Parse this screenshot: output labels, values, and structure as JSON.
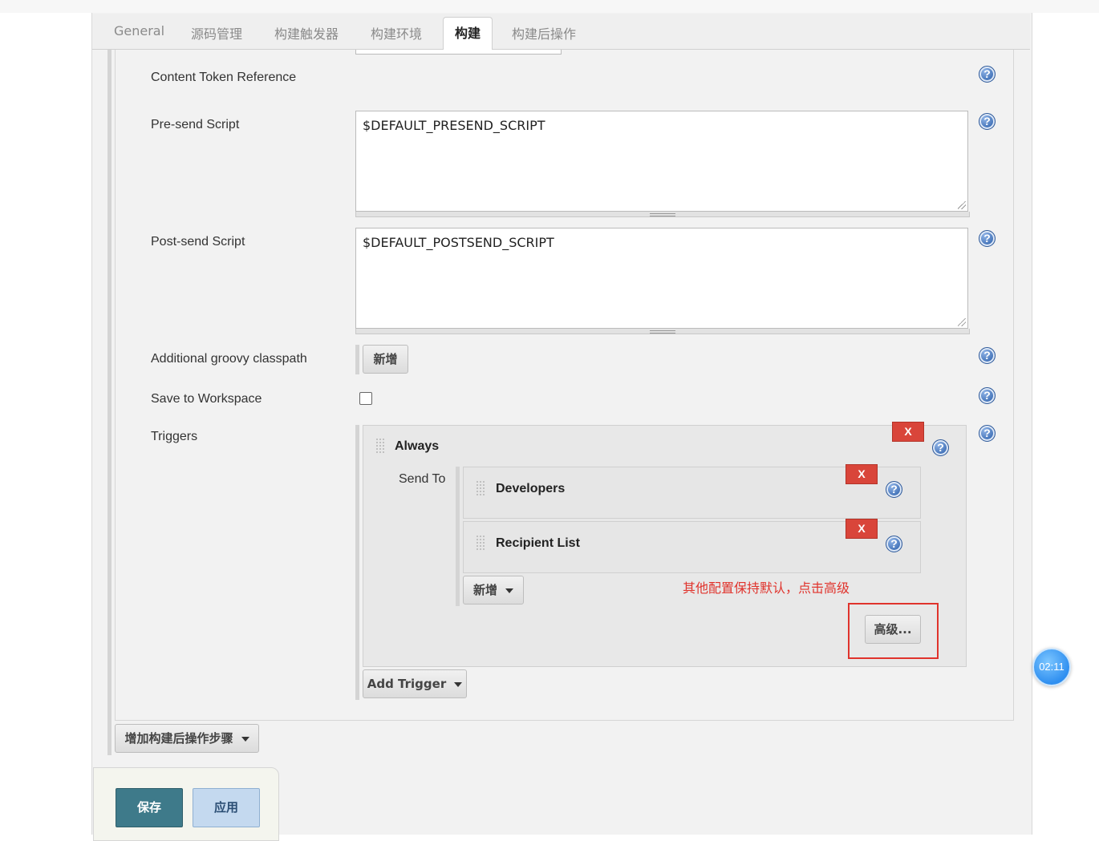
{
  "tabs": [
    "General",
    "源码管理",
    "构建触发器",
    "构建环境",
    "构建",
    "构建后操作"
  ],
  "active_tab": "构建",
  "fields": {
    "content_token_reference": "Content Token Reference",
    "pre_send_script_label": "Pre-send Script",
    "pre_send_script_value": "$DEFAULT_PRESEND_SCRIPT",
    "post_send_script_label": "Post-send Script",
    "post_send_script_value": "$DEFAULT_POSTSEND_SCRIPT",
    "groovy_classpath_label": "Additional groovy classpath",
    "groovy_add_button": "新增",
    "save_to_workspace_label": "Save to Workspace",
    "save_to_workspace_checked": false,
    "triggers_label": "Triggers"
  },
  "trigger": {
    "name": "Always",
    "remove_label": "X",
    "send_to_label": "Send To",
    "recipients": [
      {
        "name": "Developers",
        "remove_label": "X"
      },
      {
        "name": "Recipient List",
        "remove_label": "X"
      }
    ],
    "add_recipient_button": "新增",
    "advanced_button": "高级...",
    "annotation": "其他配置保持默认，点击高级"
  },
  "add_trigger_button": "Add Trigger",
  "add_post_build_step_button": "增加构建后操作步骤",
  "footer": {
    "save_button": "保存",
    "apply_button": "应用"
  },
  "timer": "02:11",
  "colors": {
    "danger": "#d9453a",
    "annotation": "#e0332c",
    "save": "#3e7a8a",
    "apply": "#c4d9ef"
  }
}
